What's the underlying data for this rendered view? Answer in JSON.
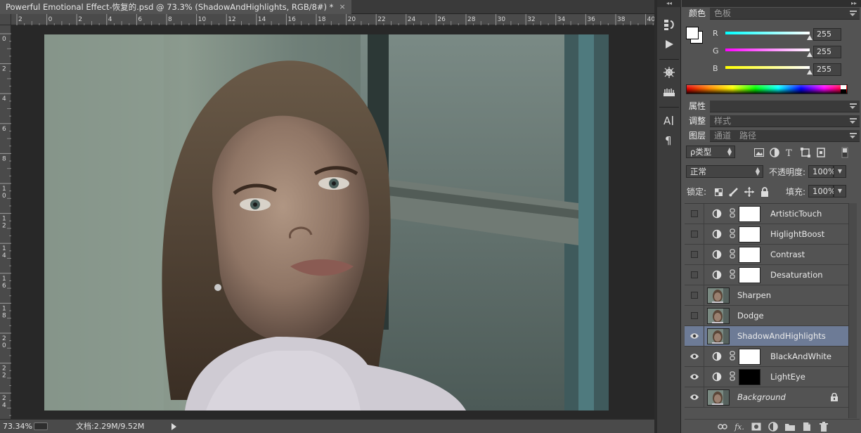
{
  "document": {
    "tab_title": "Powerful Emotional Effect-恢复的.psd @ 73.3% (ShadowAndHighlights, RGB/8#) *",
    "close_glyph": "×",
    "ruler_h_labels": [
      "2",
      "0",
      "2",
      "4",
      "6",
      "8",
      "10",
      "12",
      "14",
      "16",
      "18",
      "20",
      "22",
      "24",
      "26",
      "28",
      "30",
      "32",
      "34",
      "36",
      "38",
      "40"
    ],
    "ruler_v_labels": [
      "0",
      "2",
      "4",
      "6",
      "8",
      "1 0",
      "1 2",
      "1 4",
      "1 6",
      "1 8",
      "2 0",
      "2 2",
      "2 4"
    ]
  },
  "status": {
    "zoom": "73.34%",
    "doc_info": "文档:2.29M/9.52M"
  },
  "toolstrip": {
    "tools": [
      "history-icon",
      "actions-play-icon",
      "brush-settings-icon",
      "clone-source-icon",
      "character-icon",
      "paragraph-icon"
    ]
  },
  "color_panel": {
    "tabs": [
      "颜色",
      "色板"
    ],
    "active_tab": "颜色",
    "channels": [
      {
        "label": "R",
        "value": "255",
        "color": "#00ffff"
      },
      {
        "label": "G",
        "value": "255",
        "color": "#ff00ff"
      },
      {
        "label": "B",
        "value": "255",
        "color": "#ffff00"
      }
    ],
    "foreground": "#ffffff",
    "background": "#ffffff"
  },
  "properties_panel": {
    "tab": "属性"
  },
  "adjust_panel": {
    "tabs": [
      "调整",
      "样式"
    ],
    "active_tab": "调整"
  },
  "layers_panel": {
    "tabs": [
      "图层",
      "通道",
      "路径"
    ],
    "active_tab": "图层",
    "filter_kind": "ρ类型",
    "blend_mode": "正常",
    "opacity_label": "不透明度:",
    "opacity_value": "100%",
    "lock_label": "锁定:",
    "fill_label": "填充:",
    "fill_value": "100%",
    "layers": [
      {
        "name": "ArtisticTouch",
        "visible": false,
        "type": "adjustment",
        "mask": "white",
        "selected": false,
        "italic": false
      },
      {
        "name": "HiglightBoost",
        "visible": false,
        "type": "adjustment",
        "mask": "white",
        "selected": false,
        "italic": false
      },
      {
        "name": "Contrast",
        "visible": false,
        "type": "adjustment",
        "mask": "white",
        "selected": false,
        "italic": false
      },
      {
        "name": "Desaturation",
        "visible": false,
        "type": "adjustment",
        "mask": "white",
        "selected": false,
        "italic": false
      },
      {
        "name": "Sharpen",
        "visible": false,
        "type": "pixel",
        "selected": false,
        "italic": false
      },
      {
        "name": "Dodge",
        "visible": false,
        "type": "pixel",
        "selected": false,
        "italic": false
      },
      {
        "name": "ShadowAndHighlights",
        "visible": true,
        "type": "pixel",
        "selected": true,
        "italic": false
      },
      {
        "name": "BlackAndWhite",
        "visible": true,
        "type": "adjustment",
        "mask": "white",
        "selected": false,
        "italic": false
      },
      {
        "name": "LightEye",
        "visible": true,
        "type": "adjustment",
        "mask": "black",
        "selected": false,
        "italic": false
      },
      {
        "name": "Background",
        "visible": true,
        "type": "pixel",
        "selected": false,
        "italic": true,
        "locked": true
      }
    ],
    "bottom_icons": [
      "link-layers-icon",
      "fx-icon",
      "add-mask-icon",
      "new-adjustment-icon",
      "new-group-icon",
      "new-layer-icon",
      "delete-layer-icon"
    ]
  }
}
